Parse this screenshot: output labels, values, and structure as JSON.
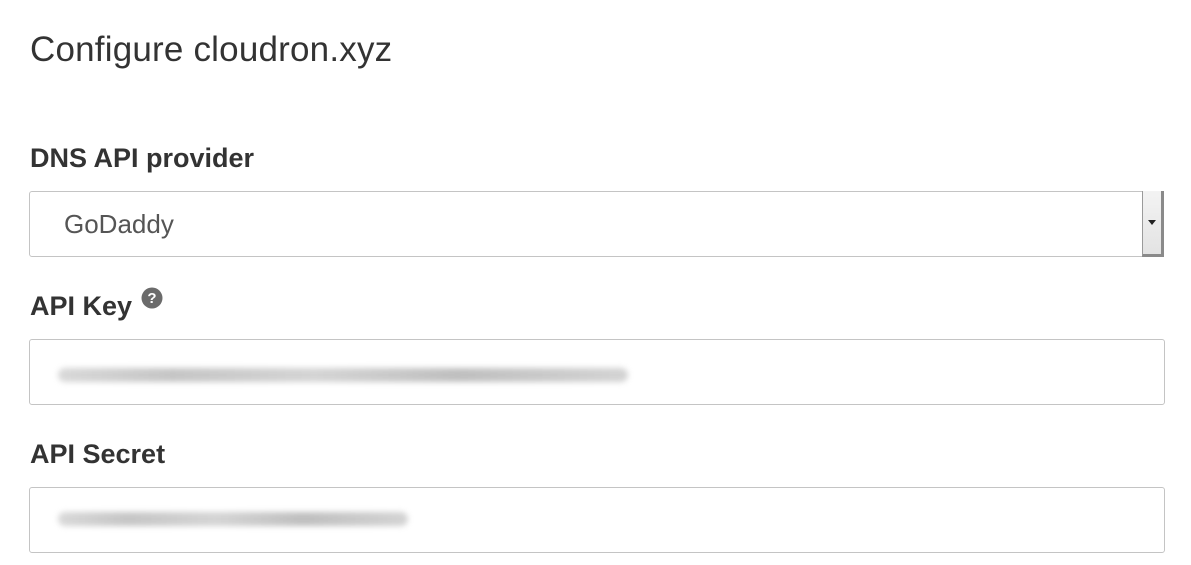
{
  "page": {
    "title": "Configure cloudron.xyz"
  },
  "form": {
    "dns_provider": {
      "label": "DNS API provider",
      "selected": "GoDaddy"
    },
    "api_key": {
      "label": "API Key",
      "help_icon": "question-circle-icon",
      "value_redacted": true
    },
    "api_secret": {
      "label": "API Secret",
      "value_redacted": true
    }
  }
}
